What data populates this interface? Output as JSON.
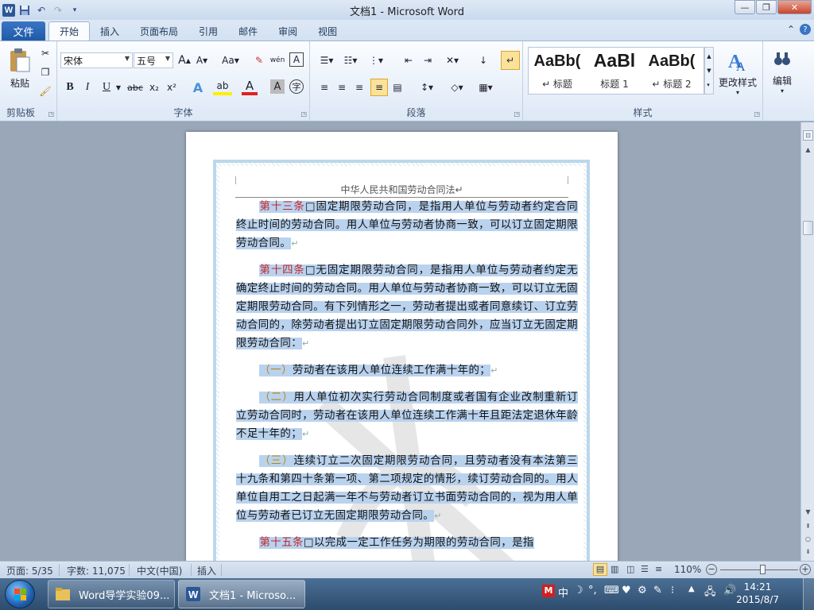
{
  "app": {
    "title": "文档1 - Microsoft Word"
  },
  "tabs": {
    "file": "文件",
    "items": [
      "开始",
      "插入",
      "页面布局",
      "引用",
      "邮件",
      "审阅",
      "视图"
    ]
  },
  "ribbon": {
    "clipboard": {
      "label": "剪贴板",
      "paste": "粘贴"
    },
    "font": {
      "label": "字体",
      "font_name": "宋体",
      "font_size": "五号",
      "grow": "A",
      "shrink": "A",
      "aa": "Aa",
      "bold": "B",
      "italic": "I",
      "underline": "U",
      "strike": "abc",
      "sub": "x₂",
      "sup": "x²",
      "color_a": "A",
      "shade_a": "A",
      "phonetic": "wén",
      "border_a": "A"
    },
    "paragraph": {
      "label": "段落"
    },
    "styles": {
      "label": "样式",
      "items": [
        {
          "sample": "AaBb(",
          "name": "↵ 标题"
        },
        {
          "sample": "AaBl",
          "name": "标题 1"
        },
        {
          "sample": "AaBb(",
          "name": "↵ 标题 2"
        }
      ],
      "change": "更改样式"
    },
    "editing": {
      "label": "编辑"
    }
  },
  "document": {
    "header": "中华人民共和国劳动合同法↵",
    "paragraphs": [
      {
        "article": "第十三条",
        "text": "□固定期限劳动合同，是指用人单位与劳动者约定合同终止时间的劳动合同。用人单位与劳动者协商一致，可以订立固定期限劳动合同。",
        "mark": "↵"
      },
      {
        "article": "第十四条",
        "text": "□无固定期限劳动合同，是指用人单位与劳动者约定无确定终止时间的劳动合同。用人单位与劳动者协商一致，可以订立无固定期限劳动合同。有下列情形之一，劳动者提出或者同意续订、订立劳动合同的，除劳动者提出订立固定期限劳动合同外，应当订立无固定期限劳动合同：",
        "mark": "↵"
      },
      {
        "article": "（一）",
        "text": "劳动者在该用人单位连续工作满十年的；",
        "mark": "↵"
      },
      {
        "article": "（二）",
        "text": "用人单位初次实行劳动合同制度或者国有企业改制重新订立劳动合同时，劳动者在该用人单位连续工作满十年且距法定退休年龄不足十年的；",
        "mark": "↵"
      },
      {
        "article": "（三）",
        "text": "连续订立二次固定期限劳动合同，且劳动者没有本法第三十九条和第四十条第一项、第二项规定的情形，续订劳动合同的。用人单位自用工之日起满一年不与劳动者订立书面劳动合同的，视为用人单位与劳动者已订立无固定期限劳动合同。",
        "mark": "↵"
      },
      {
        "article": "第十五条",
        "text": "□以完成一定工作任务为期限的劳动合同，是指",
        "mark": ""
      }
    ]
  },
  "status": {
    "page": "页面: 5/35",
    "words": "字数: 11,075",
    "lang": "中文(中国)",
    "mode": "插入",
    "zoom": "110%",
    "zoom_level": 0.55
  },
  "taskbar": {
    "items": [
      "Word导学实验09...",
      "文档1 - Microso..."
    ],
    "ime": "中",
    "time": "14:21",
    "date": "2015/8/7"
  }
}
